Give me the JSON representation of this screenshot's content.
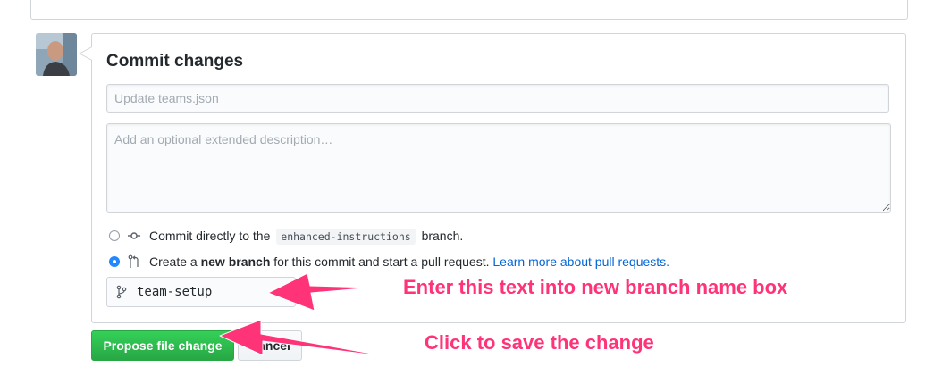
{
  "commit": {
    "title": "Commit changes",
    "summary_placeholder": "Update teams.json",
    "description_placeholder": "Add an optional extended description…"
  },
  "options": {
    "direct": {
      "prefix": "Commit directly to the",
      "branch": "enhanced-instructions",
      "suffix": "branch.",
      "selected": false
    },
    "new_branch": {
      "prefix": "Create a",
      "bold": "new branch",
      "suffix": "for this commit and start a pull request.",
      "link": "Learn more about pull requests.",
      "selected": true
    }
  },
  "branch_name": {
    "value": "team-setup"
  },
  "buttons": {
    "propose": "Propose file change",
    "cancel": "Cancel"
  },
  "annotations": {
    "branch_hint": "Enter this text into new branch name box",
    "save_hint": "Click to save the change",
    "color": "#ff3377"
  },
  "icons": {
    "commit": "git-commit-icon",
    "pull_request": "git-pull-request-icon",
    "branch": "git-branch-icon"
  },
  "colors": {
    "primary_button": "#2ea44f",
    "link": "#0366d6",
    "radio_selected": "#2188ff"
  }
}
